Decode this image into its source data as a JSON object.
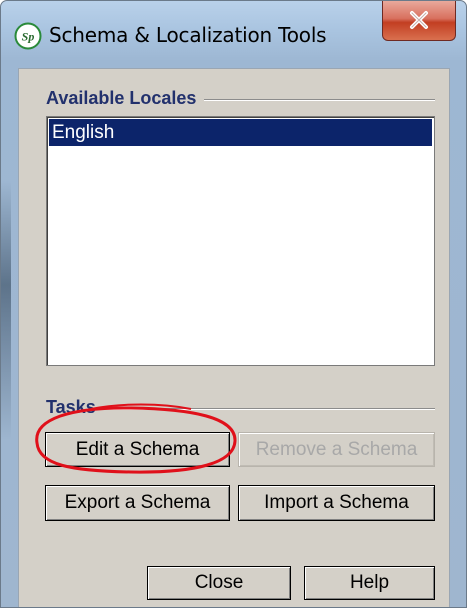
{
  "window": {
    "title": "Schema & Localization Tools",
    "app_icon_text": "Sp",
    "close_icon": "close-x-icon"
  },
  "locales": {
    "heading": "Available Locales",
    "items": [
      "English"
    ],
    "selected_index": 0
  },
  "tasks": {
    "heading": "Tasks",
    "edit_label": "Edit a Schema",
    "remove_label": "Remove a Schema",
    "remove_enabled": false,
    "export_label": "Export a Schema",
    "import_label": "Import a Schema"
  },
  "footer": {
    "close_label": "Close",
    "help_label": "Help"
  },
  "colors": {
    "selection": "#0c246a",
    "heading_text": "#22316d",
    "annotation": "#e0101a",
    "dialog_bg": "#d4d0c8"
  }
}
